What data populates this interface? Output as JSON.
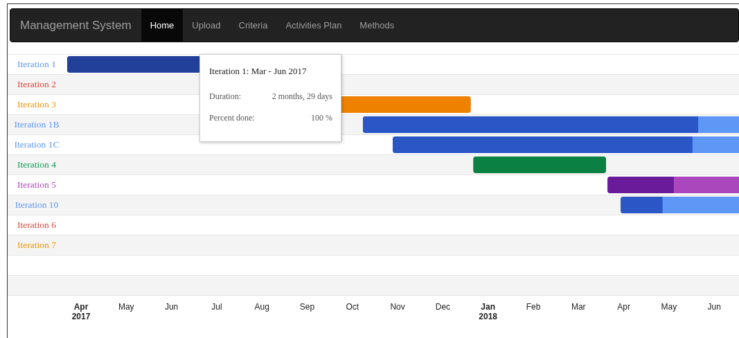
{
  "navbar": {
    "brand": "Management System",
    "items": [
      {
        "label": "Home",
        "selected": true
      },
      {
        "label": "Upload",
        "selected": false
      },
      {
        "label": "Criteria",
        "selected": false
      },
      {
        "label": "Activities Plan",
        "selected": false
      },
      {
        "label": "Methods",
        "selected": false
      }
    ]
  },
  "timeline": {
    "rows": [
      {
        "label": "Iteration 1",
        "color": "#5e97f6",
        "bar": {
          "color": "#22409a",
          "level": 1
        }
      },
      {
        "label": "Iteration 2",
        "color": "#db4437"
      },
      {
        "label": "Iteration 3",
        "color": "#f09300",
        "bar": {
          "color": "#ef8100",
          "level": 1
        }
      },
      {
        "label": "Iteration 1B",
        "color": "#5e97f6",
        "bar": {
          "color": "#2b57c6",
          "level": 0.8
        }
      },
      {
        "label": "Iteration 1C",
        "color": "#5e97f6",
        "bar": {
          "color": "#2b57c6",
          "level": 0.77
        }
      },
      {
        "label": "Iteration 4",
        "color": "#0f9d58",
        "bar": {
          "color": "#0b8043",
          "level": 1
        }
      },
      {
        "label": "Iteration 5",
        "color": "#ab47bc",
        "bar": {
          "color": "#6a1b9a",
          "level": 0.38
        }
      },
      {
        "label": "Iteration 10",
        "color": "#5e97f6",
        "bar": {
          "color": "#2b57c6",
          "level": 0.26
        }
      },
      {
        "label": "Iteration 6",
        "color": "#db4437"
      },
      {
        "label": "Iteration 7",
        "color": "#f09300"
      }
    ],
    "axis": [
      {
        "label": "Apr",
        "year": "2017"
      },
      {
        "label": "May"
      },
      {
        "label": "Jun"
      },
      {
        "label": "Jul"
      },
      {
        "label": "Aug"
      },
      {
        "label": "Sep"
      },
      {
        "label": "Oct"
      },
      {
        "label": "Nov"
      },
      {
        "label": "Dec"
      },
      {
        "label": "Jan",
        "year": "2018"
      },
      {
        "label": "Feb"
      },
      {
        "label": "Mar"
      },
      {
        "label": "Apr"
      },
      {
        "label": "May"
      },
      {
        "label": "Jun"
      }
    ],
    "tooltip": {
      "title": "Iteration 1: Mar - Jun 2017",
      "rows": [
        {
          "label": "Duration:",
          "value": "2 months, 29 days"
        },
        {
          "label": "Percent done:",
          "value": "100 %"
        }
      ]
    }
  }
}
